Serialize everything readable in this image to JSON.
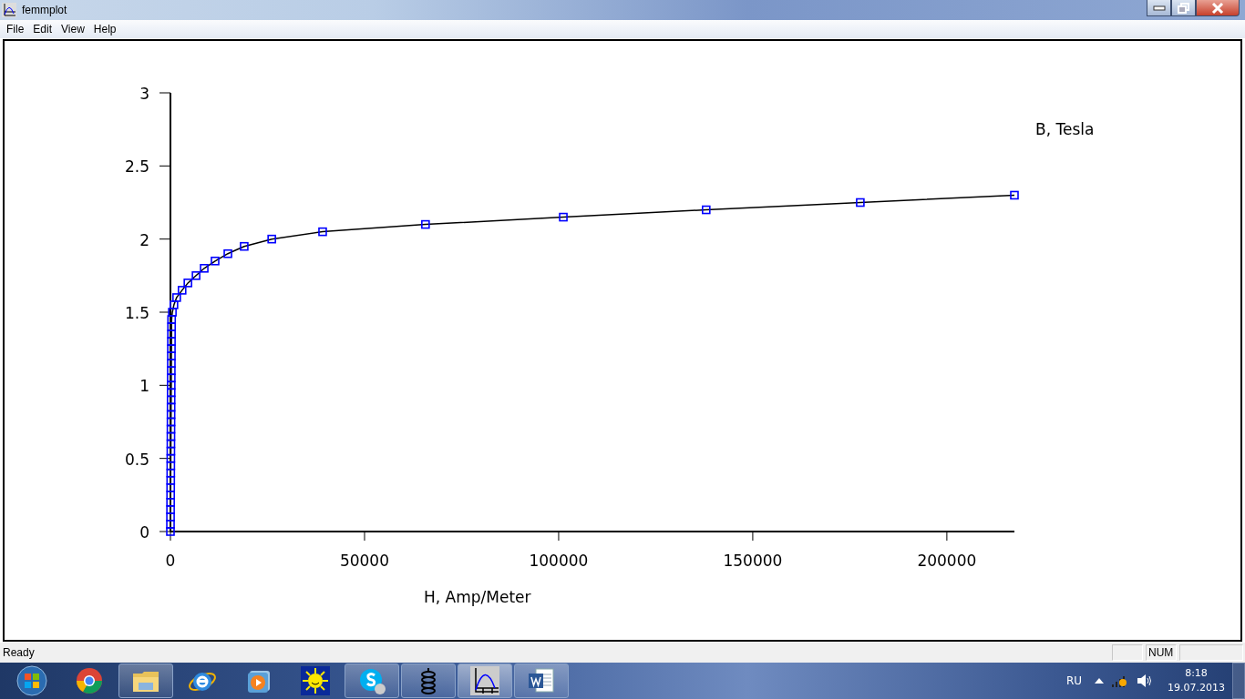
{
  "window": {
    "title": "femmplot"
  },
  "menu": [
    "File",
    "Edit",
    "View",
    "Help"
  ],
  "chart": {
    "chart_data": {
      "type": "line",
      "xlabel": "H, Amp/Meter",
      "ylabel": "B, Tesla",
      "x": [
        0,
        10,
        20,
        30,
        40,
        50,
        60,
        70,
        80,
        90,
        100,
        110,
        120,
        130,
        140,
        150,
        160,
        170,
        180,
        190,
        200,
        210,
        220,
        230,
        240,
        250,
        260,
        270,
        285,
        300,
        500,
        900,
        1600,
        3000,
        4500,
        6600,
        8700,
        11500,
        14800,
        19000,
        26100,
        39200,
        65700,
        101200,
        138000,
        177700,
        217400
      ],
      "series": [
        {
          "color": "#000000",
          "marker": "square",
          "values": [
            0,
            0.05,
            0.1,
            0.15,
            0.2,
            0.25,
            0.3,
            0.35,
            0.4,
            0.45,
            0.5,
            0.55,
            0.6,
            0.65,
            0.7,
            0.75,
            0.8,
            0.85,
            0.9,
            0.95,
            1,
            1.05,
            1.1,
            1.15,
            1.2,
            1.25,
            1.3,
            1.35,
            1.4,
            1.45,
            1.5,
            1.55,
            1.6,
            1.65,
            1.7,
            1.75,
            1.8,
            1.85,
            1.9,
            1.95,
            2,
            2.05,
            2.1,
            2.15,
            2.2,
            2.25,
            2.3
          ]
        }
      ],
      "xlim": [
        0,
        217400
      ],
      "ylim": [
        0,
        3
      ],
      "xticks": [
        0,
        50000,
        100000,
        150000,
        200000
      ],
      "yticks": [
        0,
        0.5,
        1,
        1.5,
        2,
        2.5,
        3
      ]
    }
  },
  "status_bar": {
    "text": "Ready",
    "indicator": "NUM"
  },
  "taskbar": {
    "apps": [
      {
        "kind": "chrome",
        "running": false,
        "selected": false
      },
      {
        "kind": "folder",
        "running": true,
        "selected": false
      },
      {
        "kind": "ie",
        "running": false,
        "selected": false
      },
      {
        "kind": "media",
        "running": false,
        "selected": false
      },
      {
        "kind": "sun",
        "running": false,
        "selected": false
      },
      {
        "kind": "skype",
        "running": true,
        "selected": false
      },
      {
        "kind": "coil",
        "running": true,
        "selected": false
      },
      {
        "kind": "plot",
        "running": true,
        "selected": true
      },
      {
        "kind": "word",
        "running": true,
        "selected": false
      }
    ],
    "language": "RU",
    "time": "8:18",
    "date": "19.07.2013"
  }
}
